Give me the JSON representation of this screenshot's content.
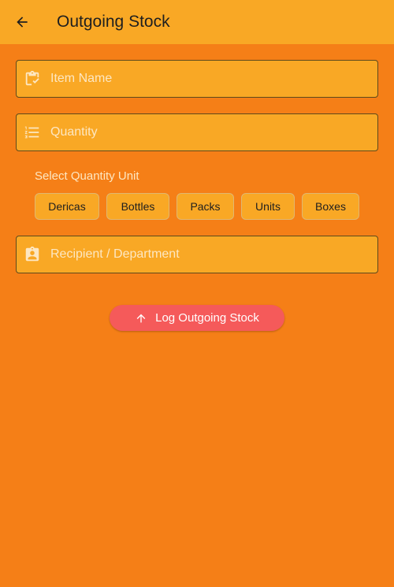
{
  "app_bar": {
    "title": "Outgoing Stock",
    "back_icon": "arrow-back-icon"
  },
  "form": {
    "item_name": {
      "placeholder": "Item Name",
      "icon": "clipboard-check-icon"
    },
    "quantity": {
      "placeholder": "Quantity",
      "icon": "list-icon"
    },
    "unit_section_label": "Select Quantity Unit",
    "units": [
      "Dericas",
      "Bottles",
      "Packs",
      "Units",
      "Boxes"
    ],
    "recipient": {
      "placeholder": "Recipient / Department",
      "icon": "assignment-ind-icon"
    }
  },
  "submit": {
    "label": "Log Outgoing Stock",
    "icon": "arrow-upward-icon"
  },
  "colors": {
    "background": "#f57f17",
    "surface": "#f9a825",
    "button": "#f55a5a"
  }
}
